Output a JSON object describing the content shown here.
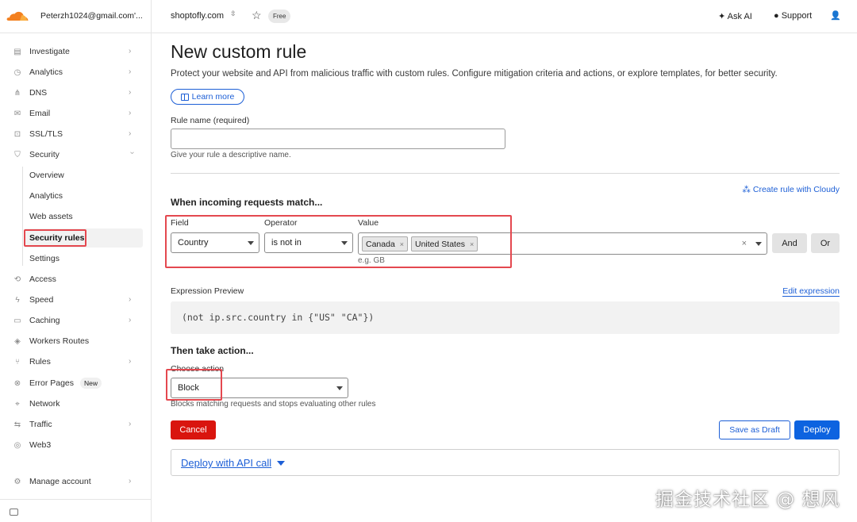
{
  "account": {
    "email": "Peterzh1024@gmail.com'..."
  },
  "topbar": {
    "domain": "shoptofly.com",
    "plan_badge": "Free",
    "ask_ai": "Ask AI",
    "support": "Support"
  },
  "sidebar": {
    "items": [
      {
        "label": "Investigate",
        "icon": "document-icon",
        "chevron": true
      },
      {
        "label": "Analytics",
        "icon": "clock-icon",
        "chevron": true
      },
      {
        "label": "DNS",
        "icon": "network-icon",
        "chevron": true
      },
      {
        "label": "Email",
        "icon": "mail-icon",
        "chevron": true
      },
      {
        "label": "SSL/TLS",
        "icon": "lock-icon",
        "chevron": true
      },
      {
        "label": "Security",
        "icon": "shield-icon",
        "chevron": true,
        "expanded": true
      },
      {
        "label": "Access",
        "icon": "access-icon",
        "chevron": false
      },
      {
        "label": "Speed",
        "icon": "bolt-icon",
        "chevron": true
      },
      {
        "label": "Caching",
        "icon": "database-icon",
        "chevron": true
      },
      {
        "label": "Workers Routes",
        "icon": "workers-icon",
        "chevron": false
      },
      {
        "label": "Rules",
        "icon": "rules-icon",
        "chevron": true
      },
      {
        "label": "Error Pages",
        "icon": "error-icon",
        "chevron": false,
        "badge": "New"
      },
      {
        "label": "Network",
        "icon": "pin-icon",
        "chevron": false
      },
      {
        "label": "Traffic",
        "icon": "traffic-icon",
        "chevron": true
      },
      {
        "label": "Web3",
        "icon": "globe-icon",
        "chevron": false
      }
    ],
    "security_sub": [
      "Overview",
      "Analytics",
      "Web assets",
      "Security rules",
      "Settings"
    ],
    "manage_account": "Manage account"
  },
  "page": {
    "title": "New custom rule",
    "description": "Protect your website and API from malicious traffic with custom rules. Configure mitigation criteria and actions, or explore templates, for better security.",
    "learn_more": "Learn more",
    "rule_name_label": "Rule name (required)",
    "rule_name_value": "",
    "rule_name_hint": "Give your rule a descriptive name.",
    "match_title": "When incoming requests match...",
    "cloudy_link": "Create rule with Cloudy",
    "field_label": "Field",
    "field_value": "Country",
    "operator_label": "Operator",
    "operator_value": "is not in",
    "value_label": "Value",
    "value_tags": [
      "Canada",
      "United States"
    ],
    "value_hint": "e.g. GB",
    "and_button": "And",
    "or_button": "Or",
    "expression_label": "Expression Preview",
    "edit_expression": "Edit expression",
    "expression": "(not ip.src.country in {\"US\" \"CA\"})",
    "action_title": "Then take action...",
    "choose_action_label": "Choose action",
    "action_value": "Block",
    "action_hint": "Blocks matching requests and stops evaluating other rules",
    "cancel": "Cancel",
    "save_draft": "Save as Draft",
    "deploy": "Deploy",
    "api_call": "Deploy with API call"
  },
  "watermark": "掘金技术社区 @ 想风",
  "colors": {
    "accent": "#0d63e0",
    "danger": "#d9150e",
    "highlight": "#e4484f",
    "brand": "#f38020"
  }
}
